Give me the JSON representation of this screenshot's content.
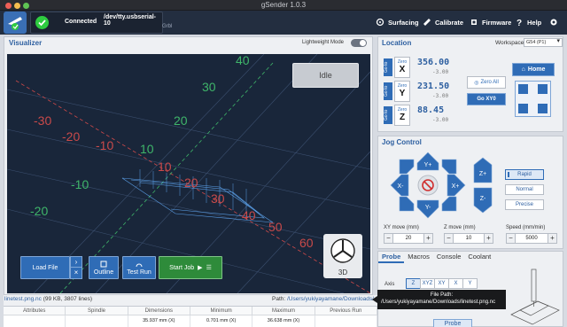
{
  "window": {
    "title": "gSender 1.0.3"
  },
  "topbar": {
    "status": "Connected",
    "port": "/dev/tty.usbserial-10",
    "firmware": "Grbl",
    "nav": [
      "Surfacing",
      "Calibrate",
      "Firmware",
      "Help",
      "Settings"
    ]
  },
  "visualizer": {
    "title": "Visualizer",
    "lightweight_label": "Lightweight Mode",
    "state": "Idle",
    "view_label": "3D",
    "grid_labels": {
      "neg_x": [
        "-30",
        "-20",
        "-10"
      ],
      "pos_x": [
        "10",
        "20",
        "30",
        "40",
        "50",
        "60"
      ],
      "y": [
        "40",
        "30",
        "20",
        "10"
      ],
      "neg_y": [
        "-10",
        "-20"
      ]
    },
    "toolbar": {
      "load_file": "Load File",
      "outline": "Outline",
      "test_run": "Test Run",
      "start_job": "Start Job"
    }
  },
  "file": {
    "name": "linetest.png.nc",
    "meta": "(99 KB, 3807 lines)",
    "path_label": "Path:",
    "path": "/Users/yukiyayamane/Downloads/"
  },
  "stats": {
    "headers": [
      "Attributes",
      "Spindle",
      "Dimensions",
      "Minimum",
      "Maximum",
      "Previous Run"
    ],
    "row": [
      "",
      "",
      "35.937 mm (X)",
      "0.701 mm (X)",
      "36.638 mm (X)",
      ""
    ]
  },
  "tooltip": {
    "title": "File Path:",
    "value": "/Users/yukiyayamane/Downloads/linetest.png.nc"
  },
  "location": {
    "title": "Location",
    "workspace_label": "Workspace:",
    "workspace_value": "G54 (P1)",
    "goto_label": "Go to",
    "zero_label": "Zero",
    "axes": [
      {
        "name": "X",
        "value": "356.00",
        "machine": "-3.00"
      },
      {
        "name": "Y",
        "value": "231.50",
        "machine": "-3.00"
      },
      {
        "name": "Z",
        "value": "88.45",
        "machine": "-3.00"
      }
    ],
    "zero_all": "Zero All",
    "go_xy0": "Go XY0",
    "home": "Home"
  },
  "jog": {
    "title": "Jog Control",
    "labels": {
      "yplus": "Y+",
      "yminus": "Y-",
      "xplus": "X+",
      "xminus": "X-",
      "zplus": "Z+",
      "zminus": "Z-"
    },
    "speeds": [
      "Rapid",
      "Normal",
      "Precise"
    ],
    "xy_label": "XY move (mm)",
    "xy_value": "20",
    "z_label": "Z move (mm)",
    "z_value": "10",
    "speed_label": "Speed (mm/min)",
    "speed_value": "5000"
  },
  "probe": {
    "tabs": [
      "Probe",
      "Macros",
      "Console",
      "Coolant"
    ],
    "axis_label": "Axis",
    "axes": [
      "Z",
      "XYZ",
      "XY",
      "X",
      "Y"
    ],
    "button": "Probe"
  },
  "colors": {
    "accent": "#2f6cb6",
    "topbar": "#232e40",
    "canvas": "#19263a",
    "connected": "#2ecc40",
    "start_job": "#2e8b3a"
  }
}
